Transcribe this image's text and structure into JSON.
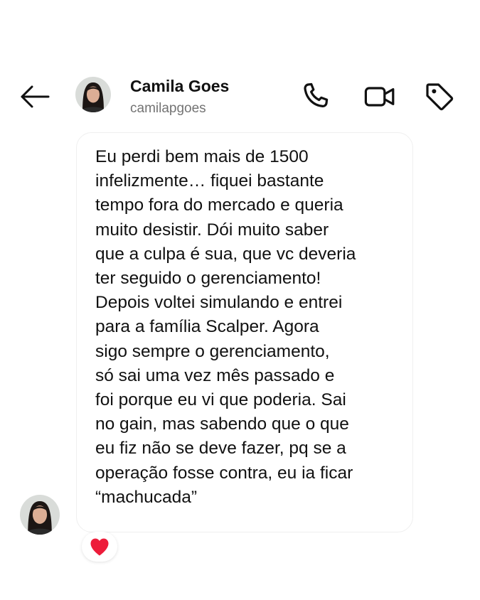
{
  "header": {
    "back_icon": "arrow-left-icon",
    "contact_name": "Camila Goes",
    "contact_handle": "camilapgoes",
    "actions": [
      {
        "name": "call",
        "icon": "phone-icon"
      },
      {
        "name": "video-call",
        "icon": "video-camera-icon"
      },
      {
        "name": "tag",
        "icon": "tag-icon"
      }
    ]
  },
  "message": {
    "text": "Eu perdi bem mais de 1500\ninfelizmente… fiquei bastante\ntempo fora do mercado e queria\nmuito desistir. Dói muito saber\nque a culpa é sua, que vc deveria\nter seguido o gerenciamento!\nDepois voltei simulando e entrei\npara a família Scalper. Agora\nsigo sempre o gerenciamento,\nsó sai uma vez mês passado e\nfoi porque eu vi que poderia. Sai\nno gain, mas sabendo que o que\neu fiz não se deve fazer, pq se a\noperação fosse contra, eu ia ficar\n“machucada”",
    "reaction": "❤"
  },
  "colors": {
    "text": "#111111",
    "secondary_text": "#737373",
    "bubble_border": "#efefef",
    "reaction_heart": "#ed1c3a"
  }
}
